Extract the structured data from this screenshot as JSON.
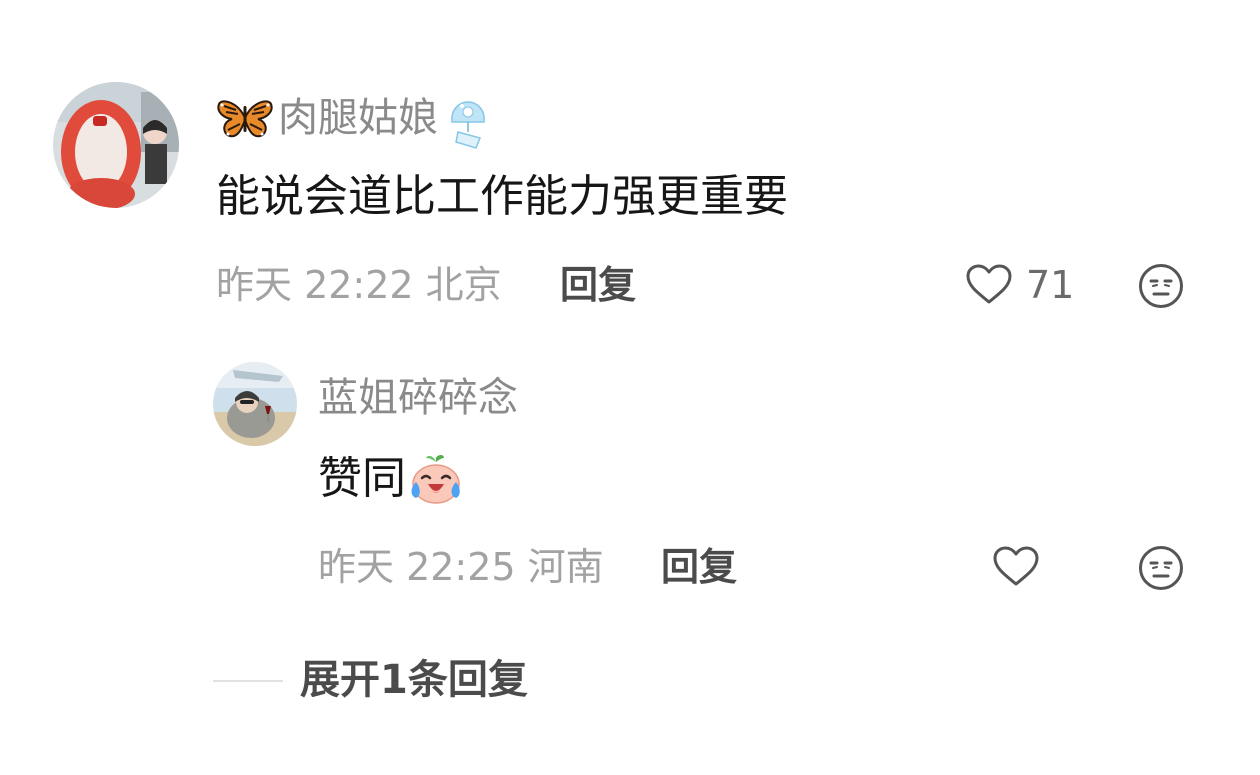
{
  "comments": [
    {
      "author": "肉腿姑娘",
      "author_prefix_icon": "butterfly-icon",
      "author_suffix_icon": "wind-chime-icon",
      "text": "能说会道比工作能力强更重要",
      "meta": "昨天 22:22 北京",
      "reply_label": "回复",
      "like_count": "71",
      "replies": [
        {
          "author": "蓝姐碎碎念",
          "text": "赞同",
          "text_emoji": "laughing-tears-emoji",
          "meta": "昨天 22:25 河南",
          "reply_label": "回复",
          "like_count": ""
        }
      ],
      "expand_label": "展开1条回复"
    }
  ],
  "colors": {
    "name": "#8a8a8a",
    "text": "#161616",
    "meta": "#a2a2a2",
    "reply": "#4b4b4b",
    "icon": "#555555"
  }
}
